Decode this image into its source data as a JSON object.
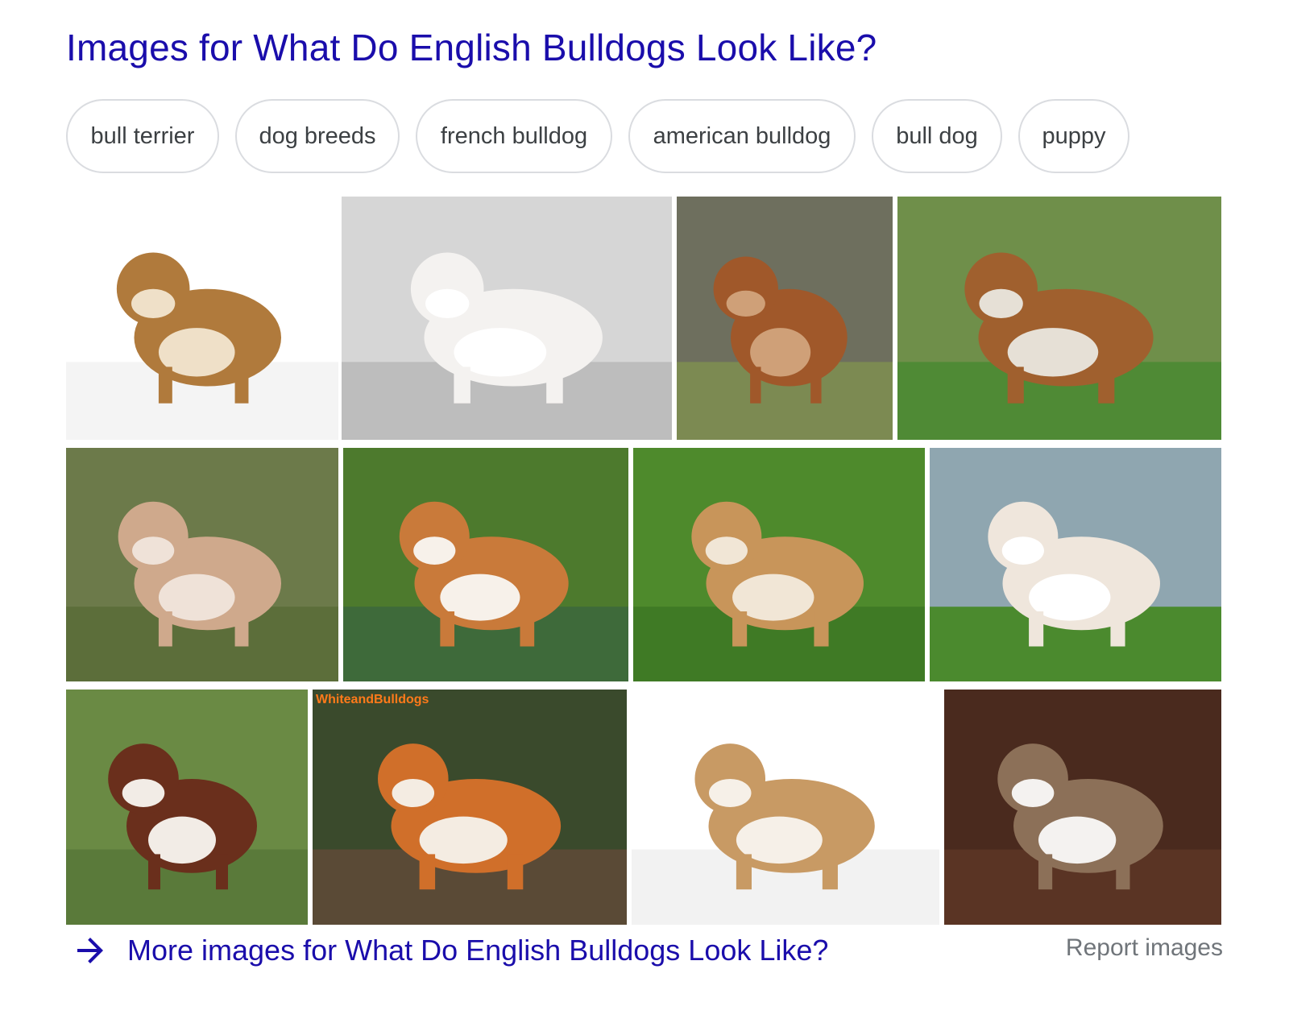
{
  "title": "Images for What Do English Bulldogs Look Like?",
  "chips": [
    "bull terrier",
    "dog breeds",
    "french bulldog",
    "american bulldog",
    "bull dog",
    "puppy"
  ],
  "images": [
    {
      "name": "bulldog-anatomy-diagram",
      "watermark": "",
      "colors": {
        "bg": "#ffffff",
        "ground": "#f4f4f4",
        "body": "#b07a3c",
        "belly": "#efe0c8"
      }
    },
    {
      "name": "two-white-puppies",
      "watermark": "",
      "colors": {
        "bg": "#d6d6d6",
        "ground": "#bdbdbd",
        "body": "#f4f2f0",
        "belly": "#ffffff"
      }
    },
    {
      "name": "brown-bulldog-garden",
      "watermark": "",
      "colors": {
        "bg": "#6e6f5e",
        "ground": "#7c8a52",
        "body": "#a0582a",
        "belly": "#cfa078"
      }
    },
    {
      "name": "fawn-bulldog-grass",
      "watermark": "",
      "colors": {
        "bg": "#6f8f4a",
        "ground": "#4f8a35",
        "body": "#a0602e",
        "belly": "#e6e0d6"
      }
    },
    {
      "name": "tan-bulldog-harness",
      "watermark": "",
      "colors": {
        "bg": "#6c7a4a",
        "ground": "#5c6e3a",
        "body": "#cfa98c",
        "belly": "#efe2d8"
      }
    },
    {
      "name": "puppy-in-water",
      "watermark": "",
      "colors": {
        "bg": "#4d7a2d",
        "ground": "#3e6a3a",
        "body": "#c97a3a",
        "belly": "#f7f1ea"
      }
    },
    {
      "name": "bulldog-scarf-grass",
      "watermark": "",
      "colors": {
        "bg": "#4e8a2c",
        "ground": "#3f7a25",
        "body": "#c8955a",
        "belly": "#f1e6d6"
      }
    },
    {
      "name": "bulldog-by-lake",
      "watermark": "",
      "colors": {
        "bg": "#8fa6b0",
        "ground": "#4b8a2e",
        "body": "#efe6dc",
        "belly": "#ffffff"
      }
    },
    {
      "name": "brown-white-bulldog",
      "watermark": "",
      "colors": {
        "bg": "#6a8a44",
        "ground": "#5a7a3a",
        "body": "#6a2f1c",
        "belly": "#f2ece6"
      }
    },
    {
      "name": "two-puppies-orange",
      "watermark": "WhiteandBulldogs",
      "colors": {
        "bg": "#3a4a2c",
        "ground": "#5a4a36",
        "body": "#d06f2a",
        "belly": "#f4ece2"
      }
    },
    {
      "name": "bulldog-side-profile",
      "watermark": "",
      "colors": {
        "bg": "#ffffff",
        "ground": "#f2f2f2",
        "body": "#c89a64",
        "belly": "#f6f0e8"
      }
    },
    {
      "name": "brindle-puppy-floor",
      "watermark": "",
      "colors": {
        "bg": "#4a2a1e",
        "ground": "#5a3424",
        "body": "#8c7058",
        "belly": "#f4f2f0"
      }
    }
  ],
  "more_link": "More images for What Do English Bulldogs Look Like?",
  "report_link": "Report images"
}
